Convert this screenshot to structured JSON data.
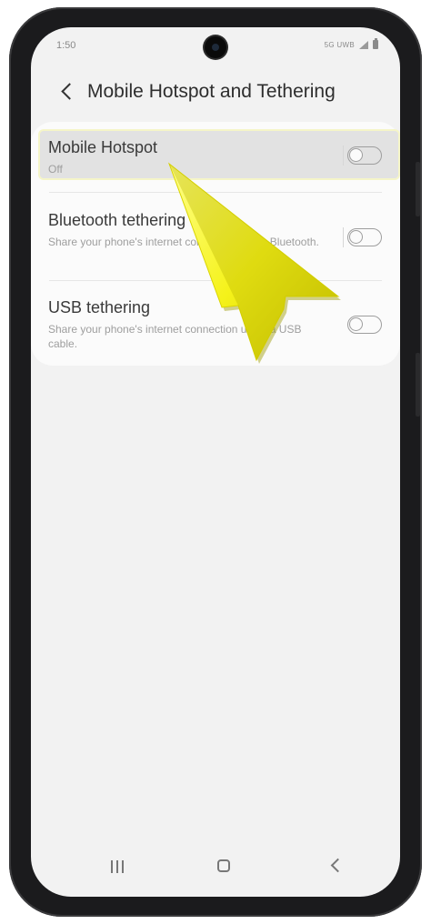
{
  "status_bar": {
    "time": "1:50",
    "network": "5G UWB",
    "icons": [
      "signal-icon",
      "battery-icon"
    ]
  },
  "header": {
    "back_icon": "chevron-left-icon",
    "title": "Mobile Hotspot and Tethering"
  },
  "settings": [
    {
      "label": "Mobile Hotspot",
      "subtitle": "Off",
      "enabled": false
    },
    {
      "label": "Bluetooth tethering",
      "subtitle": "Share your phone's internet connection using Bluetooth.",
      "enabled": false
    },
    {
      "label": "USB tethering",
      "subtitle": "Share your phone's internet connection using a USB cable.",
      "enabled": false
    }
  ],
  "nav_bar": {
    "icons": [
      "recent-apps-icon",
      "home-icon",
      "back-icon"
    ]
  },
  "colors": {
    "screen_bg": "#f2f2f2",
    "card_bg": "#fbfbfb",
    "highlight": "#e2e2e2",
    "pointer": "#f5f21a"
  }
}
